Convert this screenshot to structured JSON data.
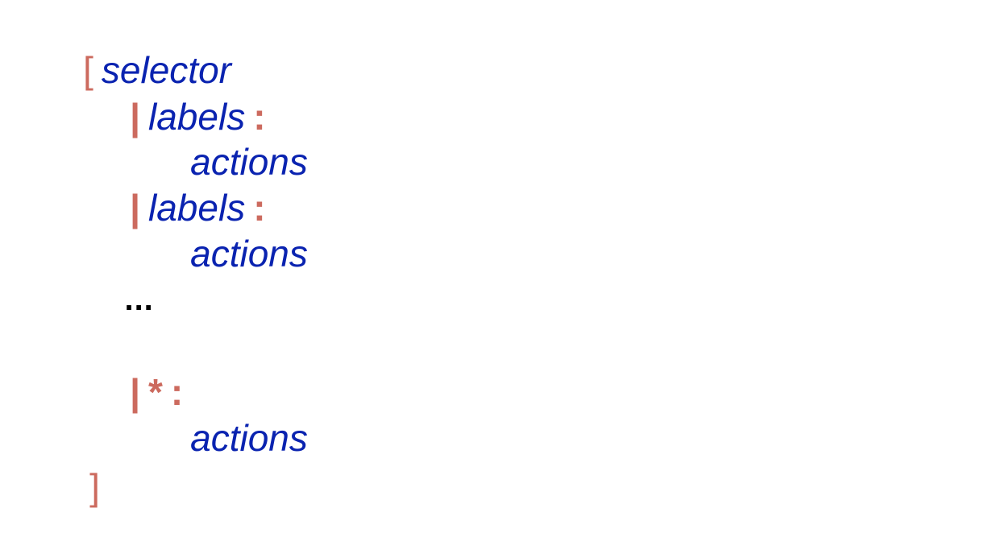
{
  "syntax": {
    "open_bracket": "[",
    "selector": "selector",
    "branch_bar": "|",
    "labels": "labels",
    "colon": ":",
    "actions": "actions",
    "ellipsis": "...",
    "wildcard": "*",
    "close_bracket": "]"
  },
  "colors": {
    "keyword": "#0a23b0",
    "symbol": "#cc6a5e",
    "ellipsis": "#000000",
    "background": "#ffffff"
  }
}
